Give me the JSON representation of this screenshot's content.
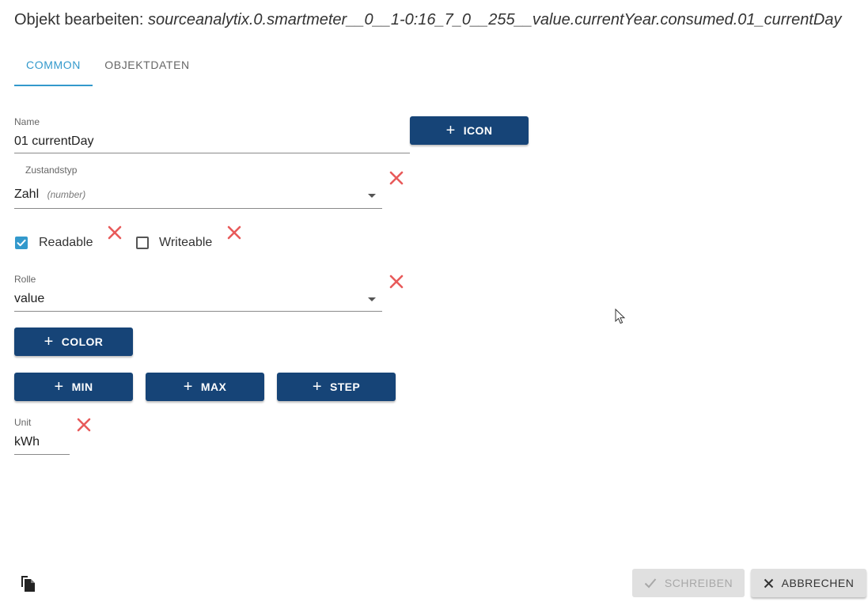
{
  "dialog": {
    "title_prefix": "Objekt bearbeiten:",
    "object_id": "sourceanalytix.0.smartmeter__0__1-0:16_7_0__255__value.currentYear.consumed.01_currentDay"
  },
  "tabs": [
    {
      "label": "COMMON",
      "active": true
    },
    {
      "label": "OBJEKTDATEN",
      "active": false
    }
  ],
  "form": {
    "name": {
      "label": "Name",
      "value": "01 currentDay"
    },
    "icon_button": "ICON",
    "state_type": {
      "label": "Zustandstyp",
      "value": "Zahl",
      "hint": "(number)"
    },
    "readable": {
      "label": "Readable",
      "checked": true
    },
    "writeable": {
      "label": "Writeable",
      "checked": false
    },
    "role": {
      "label": "Rolle",
      "value": "value"
    },
    "color_button": "COLOR",
    "min_button": "MIN",
    "max_button": "MAX",
    "step_button": "STEP",
    "unit": {
      "label": "Unit",
      "value": "kWh"
    }
  },
  "footer": {
    "write_label": "SCHREIBEN",
    "cancel_label": "ABBRECHEN"
  },
  "icons": {
    "delete": "close-icon",
    "copy": "copy-icon",
    "check": "check-icon",
    "cursor": "mouse-cursor-icon"
  },
  "colors": {
    "primary": "#164477",
    "accent": "#3399cc",
    "delete": "#e85a5a"
  }
}
